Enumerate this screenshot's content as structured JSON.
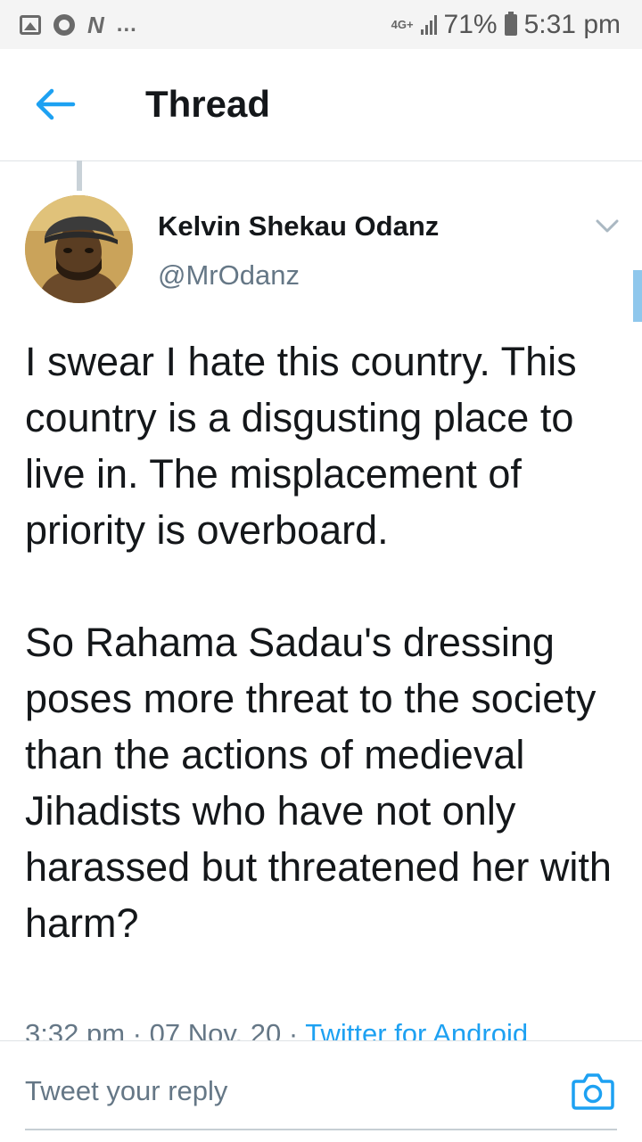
{
  "status_bar": {
    "network": "4G+",
    "battery": "71%",
    "time": "5:31 pm",
    "left_icons": [
      "gallery-icon",
      "circle-app-icon",
      "n-app-icon"
    ],
    "more": "..."
  },
  "header": {
    "title": "Thread",
    "back_icon": "arrow-left-icon"
  },
  "tweet": {
    "author_name": "Kelvin Shekau Odanz",
    "author_handle": "@MrOdanz",
    "paragraph_1": "I swear I hate this country. This country is a disgusting place to live in. The misplacement of priority is overboard.",
    "paragraph_2": "So Rahama Sadau's dressing poses more threat to the society than the actions of medieval Jihadists who have not only harassed but threatened her with harm?",
    "time": "3:32 pm",
    "date": "07 Nov. 20",
    "separator": "·",
    "source": "Twitter for Android"
  },
  "reply": {
    "placeholder": "Tweet your reply",
    "camera_icon": "camera-icon"
  },
  "colors": {
    "accent": "#1da1f2",
    "text_primary": "#14171a",
    "text_secondary": "#657786"
  }
}
